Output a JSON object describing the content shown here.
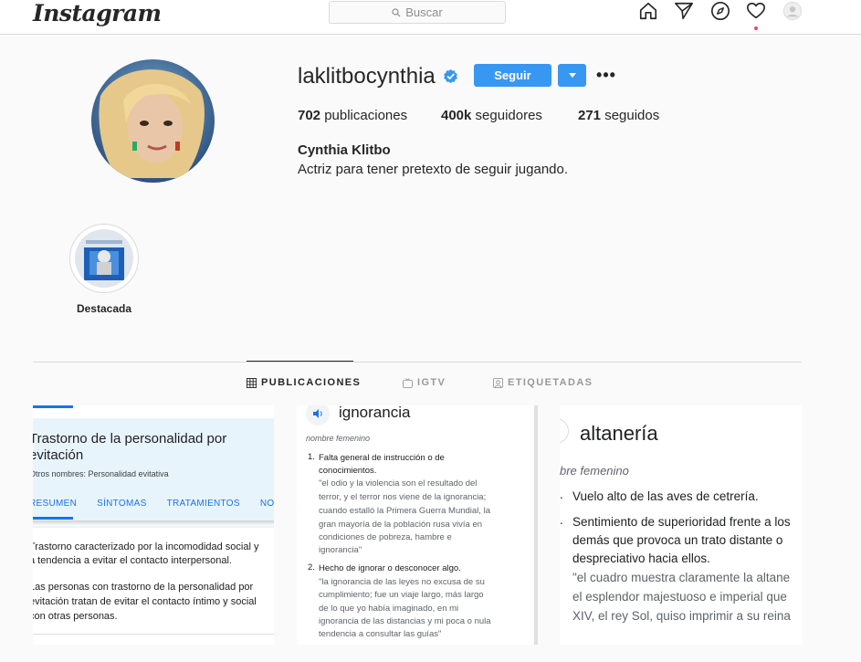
{
  "app": {
    "logo": "Instagram"
  },
  "search": {
    "placeholder": "Buscar"
  },
  "nav": {
    "icons": [
      "home-icon",
      "direct-icon",
      "explore-icon",
      "activity-icon",
      "profile-avatar-icon"
    ]
  },
  "profile": {
    "username": "laklitbocynthia",
    "verified": true,
    "follow_label": "Seguir",
    "more_label": "•••",
    "stats": {
      "posts_count": "702",
      "posts_label": " publicaciones",
      "followers_count": "400k",
      "followers_label": " seguidores",
      "following_count": "271",
      "following_label": " seguidos"
    },
    "full_name": "Cynthia Klitbo",
    "bio": "Actriz para tener pretexto de seguir jugando."
  },
  "highlights": [
    {
      "label": "Destacada"
    }
  ],
  "tabs": [
    {
      "label": "PUBLICACIONES",
      "active": true,
      "icon": "grid-icon"
    },
    {
      "label": "IGTV",
      "active": false,
      "icon": "igtv-icon"
    },
    {
      "label": "ETIQUETADAS",
      "active": false,
      "icon": "tagged-icon"
    }
  ],
  "posts": {
    "post1": {
      "title": "Trastorno de la personalidad por evitación",
      "subtitle": "Otros nombres: Personalidad evitativa",
      "tabs": [
        "RESUMEN",
        "SÍNTOMAS",
        "TRATAMIENTOS",
        "NOTI"
      ],
      "para1_line1": "Trastorno caracterizado por la incomodidad social y",
      "para1_line2": "a tendencia a evitar el contacto interpersonal.",
      "para2_line1": "Las personas con trastorno de la personalidad por",
      "para2_line2": "evitación tratan de evitar el contacto íntimo y social",
      "para2_line3": "con otras personas."
    },
    "post2": {
      "word": "ignorancia",
      "gram": "nombre femenino",
      "def1_num": "1.",
      "def1_a": "Falta general de instrucción o de",
      "def1_b": "conocimientos.",
      "def1_ex1": "\"el odio y la violencia son el resultado del",
      "def1_ex2": "terror, y el terror nos viene de la ignorancia;",
      "def1_ex3": "cuando estalló la Primera Guerra Mundial, la",
      "def1_ex4": "gran mayoría de la población rusa vivía en",
      "def1_ex5": "condiciones de pobreza, hambre e",
      "def1_ex6": "ignorancia\"",
      "def2_num": "2.",
      "def2_a": "Hecho de ignorar o desconocer algo.",
      "def2_ex1": "\"la ignorancia de las leyes no excusa de su",
      "def2_ex2": "cumplimiento; fue un viaje largo, más largo",
      "def2_ex3": "de lo que yo había imaginado, en mi",
      "def2_ex4": "ignorancia de las distancias y mi poca o nula",
      "def2_ex5": "tendencia a consultar las guías\""
    },
    "post3": {
      "word": "altanería",
      "gram": "bre femenino",
      "li1": "Vuelo alto de las aves de cetrería.",
      "li2_a": "Sentimiento de superioridad frente a los",
      "li2_b": "demás que provoca un trato distante o",
      "li2_c": "despreciativo hacia ellos.",
      "ex1": "\"el cuadro muestra claramente la altane",
      "ex2": "el esplendor majestuoso e imperial que",
      "ex3": "XIV, el rey Sol, quiso imprimir a su reina"
    }
  }
}
